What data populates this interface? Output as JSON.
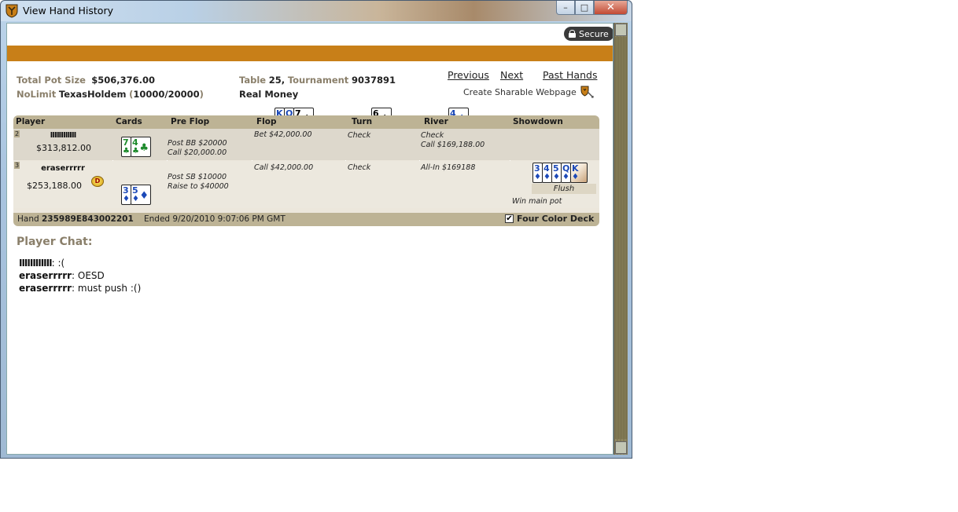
{
  "window": {
    "title": "View Hand History",
    "controls": {
      "minimize": "–",
      "maximize": "□",
      "close": "✕"
    }
  },
  "secure_badge": "Secure",
  "info": {
    "total_pot_label": "Total Pot Size",
    "total_pot_value": "$506,376.00",
    "game_limit": "NoLimit",
    "game_name": "TexasHoldem",
    "blinds": "10000/20000",
    "table_label": "Table",
    "table_number": "25",
    "tournament_label": "Tournament",
    "tournament_number": "9037891",
    "money_type": "Real Money"
  },
  "nav": {
    "previous": "Previous",
    "next": "Next",
    "past_hands": "Past Hands",
    "share": "Create Sharable Webpage"
  },
  "headers": {
    "player": "Player",
    "cards": "Cards",
    "preflop": "Pre Flop",
    "flop": "Flop",
    "turn": "Turn",
    "river": "River",
    "showdown": "Showdown"
  },
  "board": {
    "flop": [
      {
        "rank": "K",
        "suit": "♦",
        "color": "#1c49b8"
      },
      {
        "rank": "Q",
        "suit": "♦",
        "color": "#1c49b8"
      },
      {
        "rank": "7",
        "suit": "♠",
        "color": "#000000"
      }
    ],
    "turn": [
      {
        "rank": "6",
        "suit": "♠",
        "color": "#000000"
      }
    ],
    "river": [
      {
        "rank": "4",
        "suit": "♦",
        "color": "#1c49b8"
      }
    ]
  },
  "players": [
    {
      "seat": "2",
      "name": "IIIIIIIIIIII",
      "stack": "$313,812.00",
      "hole_cards": [
        {
          "rank": "7",
          "suit": "♣",
          "color": "#1d8a2b"
        },
        {
          "rank": "4",
          "suit": "♣",
          "color": "#1d8a2b"
        }
      ],
      "preflop": [
        "Post BB $20000",
        "Call $20,000.00"
      ],
      "flop": [
        "Bet $42,000.00"
      ],
      "turn": [
        "Check"
      ],
      "river": [
        "Check",
        "Call $169,188.00"
      ]
    },
    {
      "seat": "3",
      "name": "eraserrrrr",
      "stack": "$253,188.00",
      "dealer_chip": "D",
      "hole_cards": [
        {
          "rank": "3",
          "suit": "♦",
          "color": "#1c49b8"
        },
        {
          "rank": "5",
          "suit": "♦",
          "color": "#1c49b8"
        }
      ],
      "preflop": [
        "Post SB $10000",
        "Raise to $40000"
      ],
      "flop": [
        "Call $42,000.00"
      ],
      "turn": [
        "Check"
      ],
      "river": [
        "All-In $169188"
      ],
      "showdown_cards": [
        {
          "rank": "3",
          "suit": "♦",
          "color": "#1c49b8"
        },
        {
          "rank": "4",
          "suit": "♦",
          "color": "#1c49b8"
        },
        {
          "rank": "5",
          "suit": "♦",
          "color": "#1c49b8"
        },
        {
          "rank": "Q",
          "suit": "♦",
          "color": "#1c49b8"
        },
        {
          "rank": "K",
          "suit": "♦",
          "color": "#1c49b8"
        }
      ],
      "showdown_hand": "Flush",
      "result": "Win main pot"
    }
  ],
  "footer": {
    "hand_label": "Hand",
    "hand_id": "235989E843002201",
    "ended": "Ended 9/20/2010 9:07:06 PM GMT",
    "four_color": "Four Color Deck",
    "four_color_checked": "✔"
  },
  "chat": {
    "title": "Player Chat:",
    "lines": [
      {
        "name": "IIIIIIIIIIII",
        "text": ":("
      },
      {
        "name": "eraserrrrr",
        "text": "OESD"
      },
      {
        "name": "eraserrrrr",
        "text": "must push :()"
      }
    ]
  },
  "colors": {
    "accent_bar": "#c87f18",
    "table_header": "#bdb395",
    "label_text": "#8a7f6a"
  }
}
